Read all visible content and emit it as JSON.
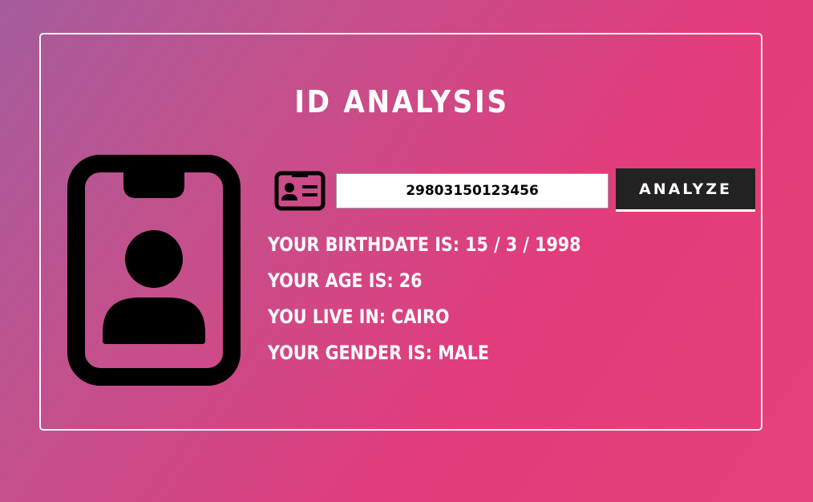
{
  "app": {
    "title": "ID Analysis"
  },
  "colors": {
    "background_start": "#a55c9c",
    "background_end": "#e6417a",
    "card_border": "#ffffff",
    "button_bg": "#222222",
    "icon_color": "#000000"
  },
  "icons": {
    "badge": "id-badge-person-icon",
    "card": "id-card-icon"
  },
  "form": {
    "id_value": "29803150123456",
    "placeholder": "",
    "analyze_label": "Analyze"
  },
  "results": {
    "birthdate": "Your Birthdate is: 15 / 3 / 1998",
    "age": "Your Age is: 26",
    "location": "You live in: Cairo",
    "gender": "Your Gender is: Male"
  }
}
